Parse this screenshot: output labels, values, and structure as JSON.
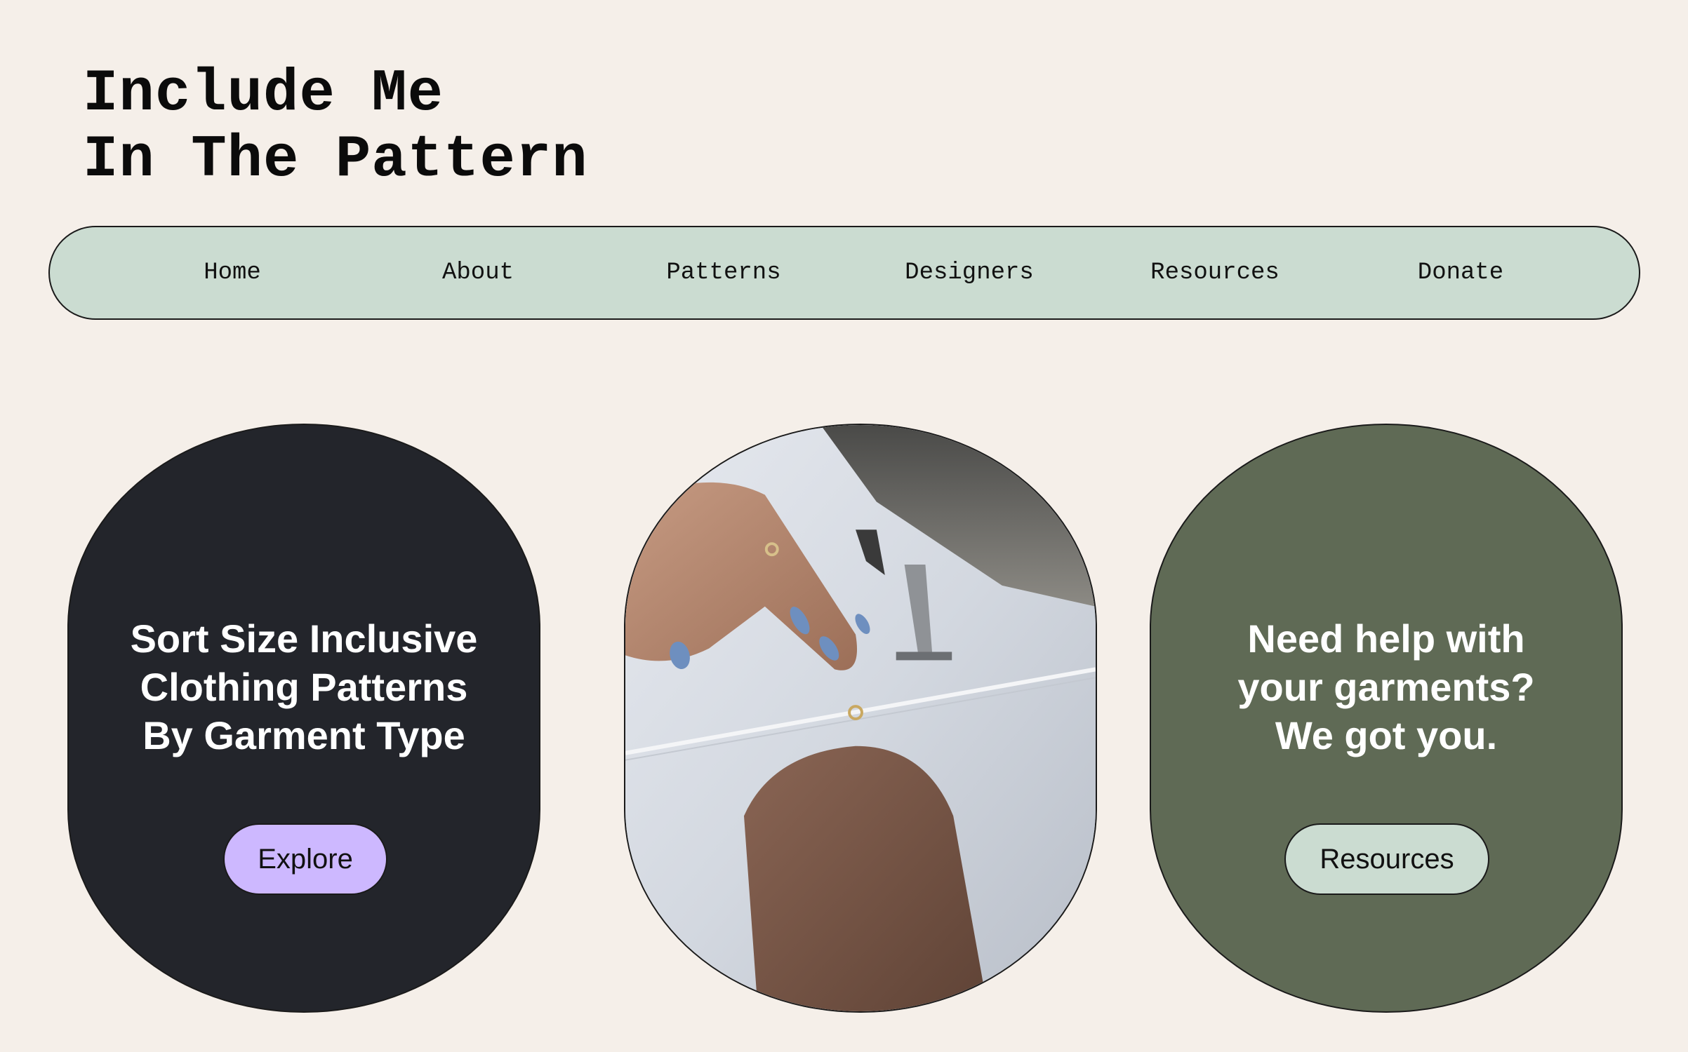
{
  "site": {
    "title_line1": "Include Me",
    "title_line2": "In The Pattern"
  },
  "nav": {
    "items": [
      {
        "label": "Home"
      },
      {
        "label": "About"
      },
      {
        "label": "Patterns"
      },
      {
        "label": "Designers"
      },
      {
        "label": "Resources"
      },
      {
        "label": "Donate"
      }
    ]
  },
  "cards": {
    "left": {
      "heading_lines": [
        "Sort Size Inclusive",
        "Clothing Patterns",
        "By Garment Type"
      ],
      "button_label": "Explore"
    },
    "center": {
      "image": "sewing-machine-hands-photo"
    },
    "right": {
      "heading_lines": [
        "Need help with",
        "your garments?",
        "We got you."
      ],
      "button_label": "Resources"
    }
  },
  "colors": {
    "background": "#f5efe9",
    "nav_bg": "#cbdcd1",
    "card_dark": "#23252b",
    "card_green": "#5f6a55",
    "explore_button": "#cdb8ff",
    "resources_button": "#cbdcd1"
  }
}
